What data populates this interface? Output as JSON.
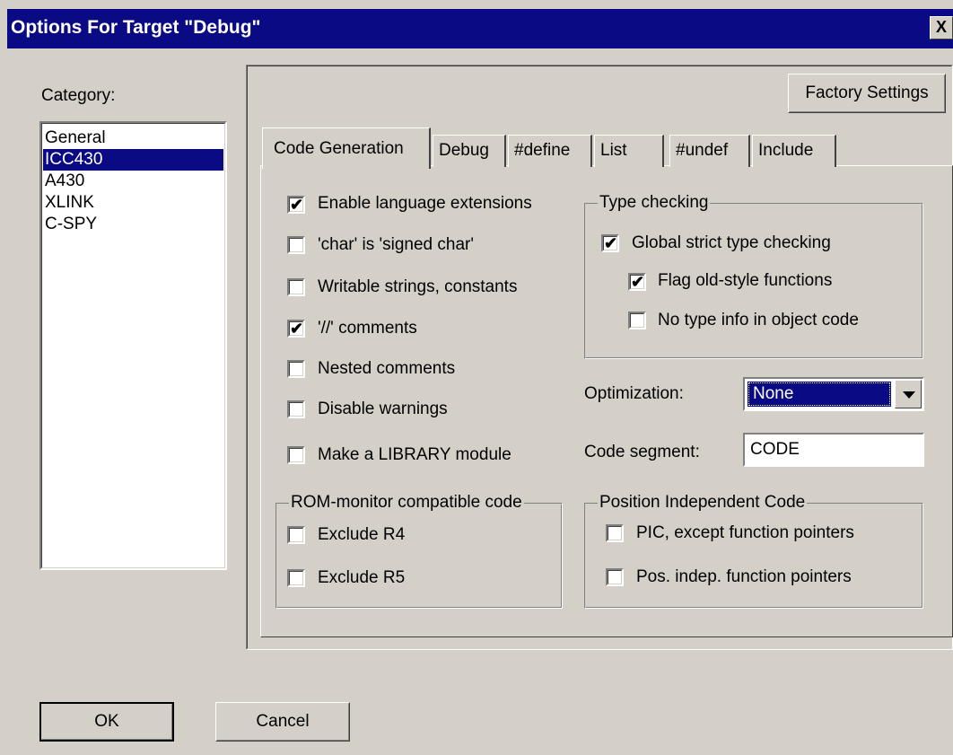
{
  "window": {
    "title": "Options For Target \"Debug\"",
    "close_glyph": "X"
  },
  "category": {
    "label": "Category:",
    "items": [
      "General",
      "ICC430",
      "A430",
      "XLINK",
      "C-SPY"
    ],
    "selected": "ICC430"
  },
  "buttons": {
    "factory": "Factory Settings",
    "ok": "OK",
    "cancel": "Cancel"
  },
  "tabs": [
    "Code Generation",
    "Debug",
    "#define",
    "List",
    "#undef",
    "Include"
  ],
  "active_tab": "Code Generation",
  "options": [
    {
      "label": "Enable language extensions",
      "checked": true
    },
    {
      "label": "'char' is 'signed char'",
      "checked": false
    },
    {
      "label": "Writable strings, constants",
      "checked": false
    },
    {
      "label": "'//' comments",
      "checked": true
    },
    {
      "label": "Nested comments",
      "checked": false
    },
    {
      "label": "Disable warnings",
      "checked": false
    },
    {
      "label": "Make a LIBRARY module",
      "checked": false
    }
  ],
  "type_checking": {
    "title": "Type checking",
    "items": [
      {
        "label": "Global strict type checking",
        "checked": true
      },
      {
        "label": "Flag old-style functions",
        "checked": true
      },
      {
        "label": "No type info in object code",
        "checked": false
      }
    ]
  },
  "optimization": {
    "label": "Optimization:",
    "value": "None"
  },
  "code_segment": {
    "label": "Code segment:",
    "value": "CODE"
  },
  "rom_monitor": {
    "title": "ROM-monitor compatible code",
    "items": [
      {
        "label": "Exclude R4",
        "checked": false
      },
      {
        "label": "Exclude R5",
        "checked": false
      }
    ]
  },
  "pic": {
    "title": "Position Independent Code",
    "items": [
      {
        "label": "PIC, except function pointers",
        "checked": false
      },
      {
        "label": "Pos. indep. function pointers",
        "checked": false
      }
    ]
  },
  "check_glyph": "✔",
  "colors": {
    "face": "#d4d0c8",
    "titlebar": "#0a0a84",
    "selection": "#0a0a84"
  }
}
